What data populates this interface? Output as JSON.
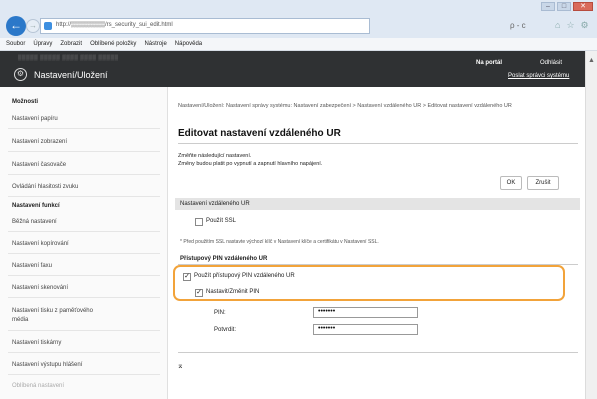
{
  "browser": {
    "url": "http://▒▒▒▒▒▒▒▒/rs_security_sui_edit.html",
    "addr_tools": "ρ - c",
    "menu": [
      "Soubor",
      "Úpravy",
      "Zobrazit",
      "Oblíbené položky",
      "Nástroje",
      "Nápověda"
    ]
  },
  "header": {
    "blurred_text": "▒▒▒▒▒ ▒▒▒▒▒ ▒▒▒▒    ▒▒▒▒ ▒▒▒▒▒",
    "title": "Nastavení/Uložení",
    "portal_link": "Na portál",
    "logout_link": "Odhlásit",
    "mail_link": "Poslat správci systému"
  },
  "sidebar": {
    "heading1": "Možnosti",
    "items1": [
      "Nastavení papíru",
      "Nastavení zobrazení",
      "Nastavení časovače",
      "Ovládání hlasitosti zvuku"
    ],
    "heading2": "Nastavení funkcí",
    "items2": [
      "Běžná nastavení",
      "Nastavení kopírování",
      "Nastavení faxu",
      "Nastavení skenování",
      "Nastavení tisku z paměťového média",
      "Nastavení tiskárny",
      "Nastavení výstupu hlášení",
      "Oblíbená nastavení"
    ]
  },
  "main": {
    "breadcrumb": "Nastavení/Uložení: Nastavení správy systému: Nastavení zabezpečení > Nastavení vzdáleného UR > Editovat nastavení vzdáleného UR",
    "title": "Editovat nastavení vzdáleného UR",
    "intro1": "Změňte následující nastavení.",
    "intro2": "Změny budou platit po vypnutí a zapnutí hlavního napájení.",
    "ok_label": "OK",
    "cancel_label": "Zrušit",
    "section_title": "Nastavení vzdáleného UR",
    "use_ssl_label": "Použít SSL",
    "note": "* Před použitím SSL nastavte výchozí klíč v Nastavení klíče a certifikátu v Nastavení SSL.",
    "pin_section_title": "Přístupový PIN vzdáleného UR",
    "use_pin_label": "Použít přístupový PIN vzdáleného UR",
    "set_pin_label": "Nastavit/Změnit PIN",
    "pin_label": "PIN:",
    "pin_value": "•••••••",
    "confirm_label": "Potvrdit:",
    "confirm_value": "•••••••",
    "top_arrow": "⌅"
  },
  "state": {
    "use_ssl": false,
    "use_pin": true,
    "set_pin": true
  }
}
